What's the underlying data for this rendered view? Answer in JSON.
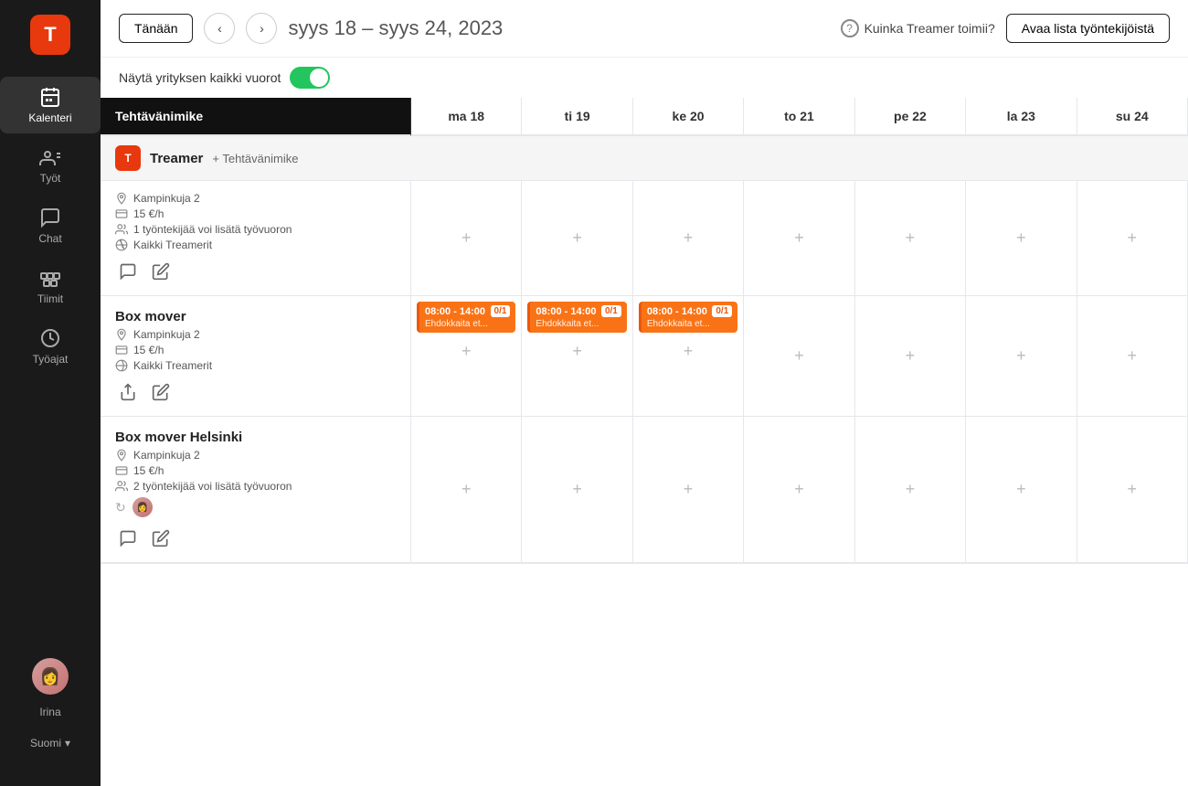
{
  "sidebar": {
    "logo_text": "T",
    "items": [
      {
        "id": "kalenteri",
        "label": "Kalenteri",
        "active": true
      },
      {
        "id": "tyot",
        "label": "Työt",
        "active": false
      },
      {
        "id": "chat",
        "label": "Chat",
        "active": false
      },
      {
        "id": "tiimit",
        "label": "Tiimit",
        "active": false
      },
      {
        "id": "tyoajat",
        "label": "Työajat",
        "active": false
      }
    ],
    "user": {
      "name": "Irina"
    },
    "lang": "Suomi"
  },
  "header": {
    "today_btn": "Tänään",
    "date_range": "syys 18 – syys 24",
    "year": ", 2023",
    "help_text": "Kuinka Treamer toimii?",
    "employees_btn": "Avaa lista työntekijöistä"
  },
  "toggle": {
    "label": "Näytä yrityksen kaikki vuorot",
    "enabled": true
  },
  "calendar": {
    "task_col_label": "Tehtävänimike",
    "days": [
      {
        "label": "ma 18"
      },
      {
        "label": "ti 19"
      },
      {
        "label": "ke 20"
      },
      {
        "label": "to 21"
      },
      {
        "label": "pe 22"
      },
      {
        "label": "la 23"
      },
      {
        "label": "su 24"
      }
    ],
    "section": {
      "name": "Treamer",
      "add_label": "+ Tehtävänimike"
    },
    "tasks": [
      {
        "name": "",
        "location": "Kampinkuja 2",
        "rate": "15 €/h",
        "workers_note": "1 työntekijää voi lisätä työvuoron",
        "group": "Kaikki Treamerit",
        "days_with_shifts": [],
        "show_refresh": false
      },
      {
        "name": "Box mover",
        "location": "Kampinkuja 2",
        "rate": "15 €/h",
        "workers_note": "",
        "group": "Kaikki Treamerit",
        "days_with_shifts": [
          0,
          1,
          2
        ],
        "shift_time": "08:00 - 14:00",
        "shift_badge": "0/1",
        "shift_sub": "Ehdokkaita et...",
        "show_refresh": true
      },
      {
        "name": "Box mover Helsinki",
        "location": "Kampinkuja 2",
        "rate": "15 €/h",
        "workers_note": "2 työntekijää voi lisätä työvuoron",
        "group": "",
        "days_with_shifts": [],
        "show_refresh": false,
        "has_avatar": true
      }
    ]
  }
}
